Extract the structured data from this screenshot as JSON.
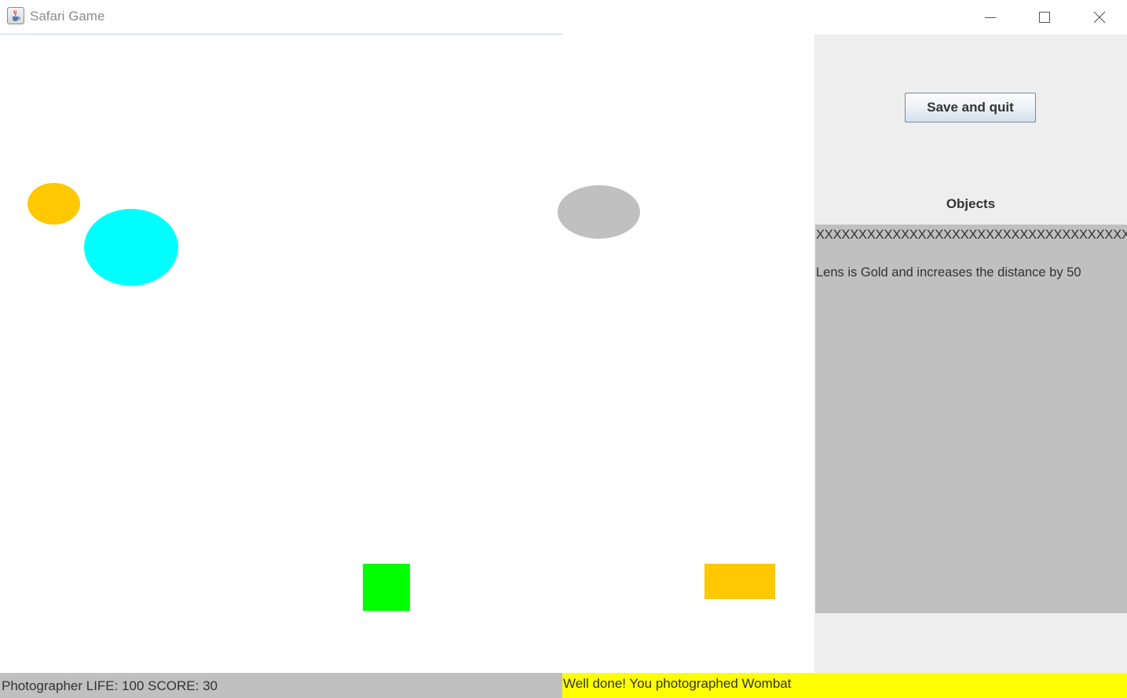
{
  "window": {
    "title": "Safari Game",
    "icon": "java-cup-icon",
    "controls": [
      "minimize-icon",
      "maximize-icon",
      "close-icon"
    ]
  },
  "canvas": {
    "background": "#ffffff",
    "shapes": [
      {
        "name": "orange-ellipse",
        "shape": "ellipse",
        "color": "#ffc800"
      },
      {
        "name": "cyan-ellipse",
        "shape": "ellipse",
        "color": "#00ffff"
      },
      {
        "name": "gray-ellipse",
        "shape": "ellipse",
        "color": "#c0c0c0"
      },
      {
        "name": "green-square",
        "shape": "rect",
        "color": "#00ff00"
      },
      {
        "name": "orange-rectangle",
        "shape": "rect",
        "color": "#ffc800"
      }
    ]
  },
  "side_panel": {
    "save_button_label": "Save and quit",
    "objects_title": "Objects",
    "objects_lines": [
      "XXXXXXXXXXXXXXXXXXXXXXXXXXXXXXXXXXXXXXXXX",
      "Lens is Gold and increases the distance by 50"
    ]
  },
  "status": {
    "player_info": "Photographer LIFE: 100 SCORE: 30",
    "message": "Well done! You photographed Wombat",
    "message_bg": "#ffff00"
  }
}
